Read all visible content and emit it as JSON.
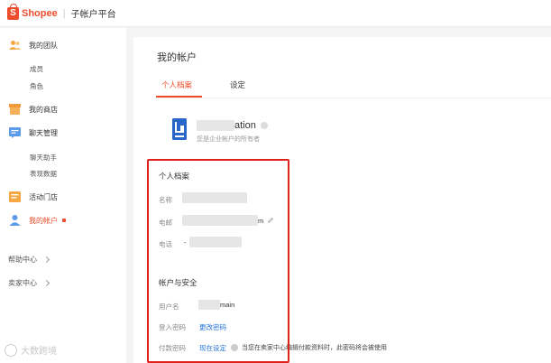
{
  "header": {
    "logo_text": "Shopee",
    "separator": "|",
    "app_title": "子帐户平台"
  },
  "sidebar": {
    "my_team": "我的团队",
    "members": "成员",
    "roles": "角色",
    "my_shop": "我的商店",
    "chat_management": "聊天管理",
    "chat_assistant": "聊天助手",
    "performance_data": "表现数据",
    "campaign_entry": "活动门店",
    "my_account": "我的帐户",
    "help_center": "帮助中心",
    "seller_center": "卖家中心"
  },
  "main": {
    "page_title": "我的帐户",
    "tabs": [
      "个人档案",
      "设定"
    ],
    "company_name_visible": "ation",
    "company_subtitle": "您是企业帐户的所有者",
    "profile_title": "个人档案",
    "name_label": "名称",
    "email_label": "电邮",
    "email_suffix": "m",
    "phone_label": "电话",
    "phone_prefix": "-",
    "security_title": "帐户与安全",
    "username_label": "用户名",
    "username_suffix": "main",
    "login_password_label": "登入密码",
    "change_password_link": "更改密码",
    "payment_password_label": "付款密码",
    "setup_now_link": "现在设定",
    "payment_note": "当您在卖家中心编辑付款资料时，此密码将会被使用"
  },
  "watermark_text": "大数跨境",
  "colors": {
    "accent": "#ee4d2d",
    "link": "#2673dd",
    "highlight_border": "#e0201a"
  }
}
